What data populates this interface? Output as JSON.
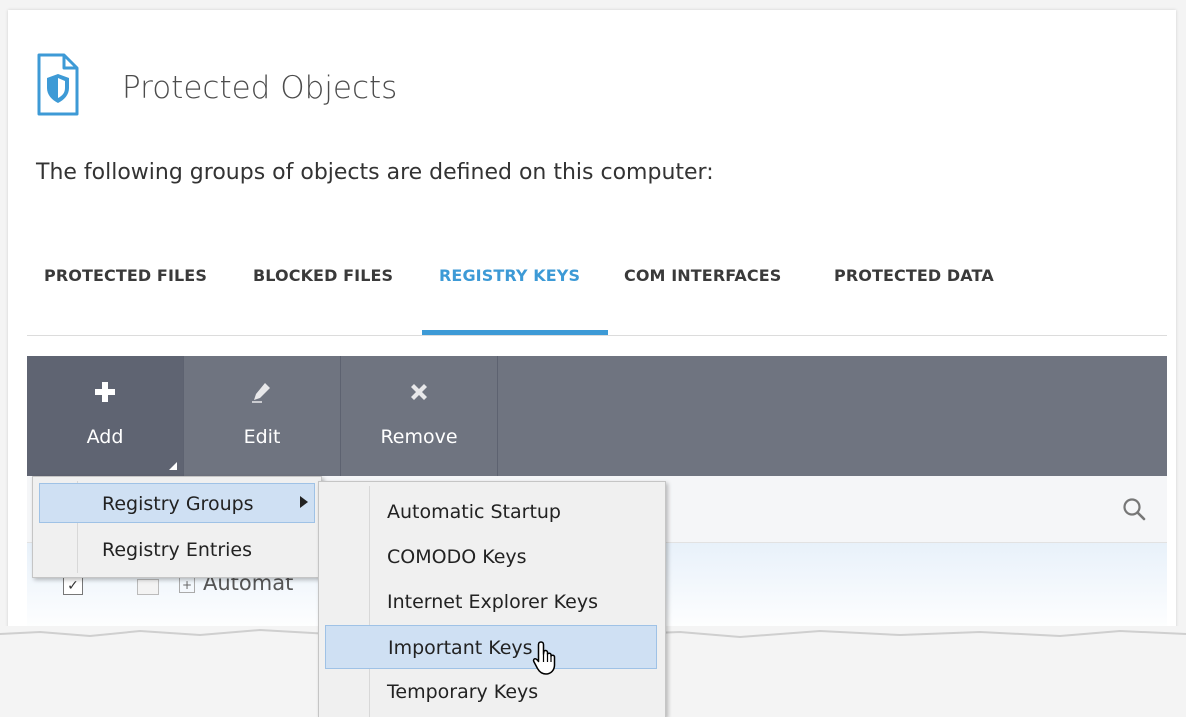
{
  "header": {
    "title": "Protected Objects",
    "subtitle": "The following groups of objects are defined on this computer:"
  },
  "tabs": [
    {
      "label": "PROTECTED FILES",
      "active": false
    },
    {
      "label": "BLOCKED FILES",
      "active": false
    },
    {
      "label": "REGISTRY KEYS",
      "active": true
    },
    {
      "label": "COM INTERFACES",
      "active": false
    },
    {
      "label": "PROTECTED DATA",
      "active": false
    }
  ],
  "toolbar": {
    "add_label": "Add",
    "edit_label": "Edit",
    "remove_label": "Remove"
  },
  "list": {
    "row_text": "Automat",
    "row_checked": true
  },
  "add_menu": {
    "items": [
      "Registry Groups",
      "Registry Entries"
    ],
    "highlighted": "Registry Groups"
  },
  "registry_groups_submenu": {
    "items": [
      "Automatic Startup",
      "COMODO Keys",
      "Internet Explorer Keys",
      "Important Keys",
      "Temporary Keys"
    ],
    "highlighted": "Important Keys"
  },
  "colors": {
    "accent": "#3d9ad6",
    "toolbar": "#6f7480",
    "menu_highlight": "#cfe0f3"
  },
  "icons": {
    "title": "shield-document-icon",
    "add": "plus-icon",
    "edit": "pencil-icon",
    "remove": "x-icon",
    "search": "search-icon",
    "cursor": "hand-pointer-icon"
  }
}
